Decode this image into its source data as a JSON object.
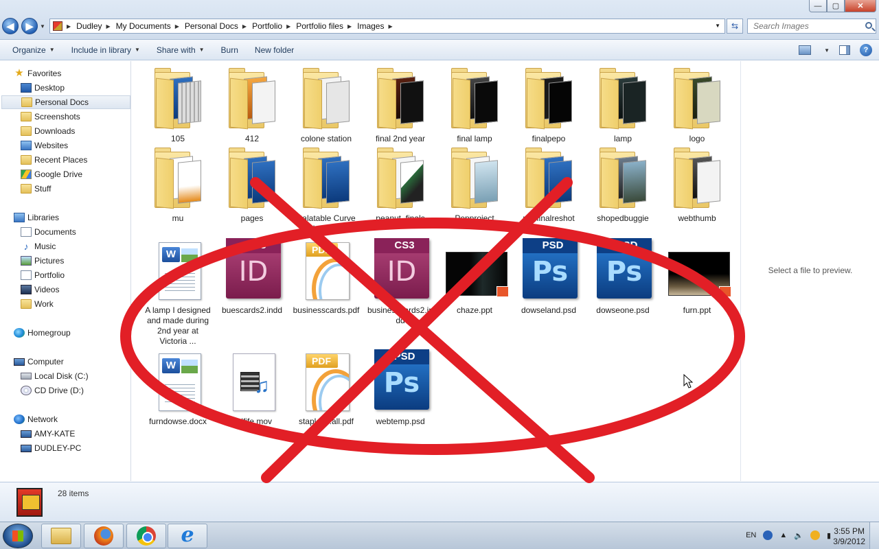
{
  "window": {
    "buttons": {
      "minimize": "—",
      "maximize": "▢",
      "close": "✕"
    }
  },
  "address": {
    "crumbs": [
      "Dudley",
      "My Documents",
      "Personal Docs",
      "Portfolio",
      "Portfolio files",
      "Images"
    ],
    "search_placeholder": "Search Images"
  },
  "toolbar": {
    "organize": "Organize",
    "include_in_library": "Include in library",
    "share_with": "Share with",
    "burn": "Burn",
    "new_folder": "New folder"
  },
  "sidebar": {
    "favorites": {
      "header": "Favorites",
      "items": [
        "Desktop",
        "Personal Docs",
        "Screenshots",
        "Downloads",
        "Websites",
        "Recent Places",
        "Google Drive",
        "Stuff"
      ]
    },
    "libraries": {
      "header": "Libraries",
      "items": [
        "Documents",
        "Music",
        "Pictures",
        "Portfolio",
        "Videos",
        "Work"
      ]
    },
    "homegroup": "Homegroup",
    "computer": {
      "header": "Computer",
      "items": [
        "Local Disk (C:)",
        "CD Drive (D:)"
      ]
    },
    "network": {
      "header": "Network",
      "items": [
        "AMY-KATE",
        "DUDLEY-PC"
      ]
    }
  },
  "files": {
    "folders_row1": [
      "105",
      "412",
      "colone station",
      "final 2nd year",
      "final lamp",
      "finalpepo",
      "lamp",
      "logo"
    ],
    "folders_row2": [
      "mu",
      "pages",
      "Palatable Curve Images",
      "peanut_finals",
      "Pepproject",
      "p... finalreshot",
      "shopedbuggie",
      "webthumb"
    ],
    "files_row1": [
      "A lamp I designed and made during 2nd year at Victoria ...",
      "buescards2.indd",
      "businesscards.pdf",
      "businesscards2.indd",
      "chaze.ppt",
      "dowseland.psd",
      "dowseone.psd",
      "furn.ppt"
    ],
    "files_row2": [
      "furndowse.docx",
      "halfife.mov",
      "staples...all.pdf",
      "webtemp.psd"
    ],
    "badges": {
      "indd": "CS3",
      "indd_letters": "ID",
      "psd": "PSD",
      "psd_letters": "Ps",
      "pdf": "PDF",
      "word": "W"
    }
  },
  "preview": {
    "message": "Select a file to preview."
  },
  "details": {
    "item_count": "28 items"
  },
  "taskbar": {
    "language": "EN",
    "time": "3:55 PM",
    "date": "3/9/2012"
  },
  "colors": {
    "annotation_red": "#e21f26",
    "accent_blue": "#1e395b"
  }
}
